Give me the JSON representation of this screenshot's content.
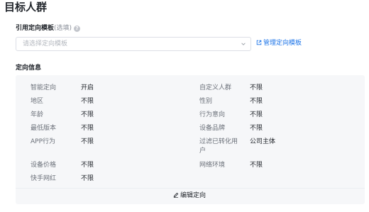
{
  "page_title": "目标人群",
  "template": {
    "label": "引用定向模板",
    "optional": "(选填)",
    "placeholder": "请选择定向模板",
    "manage_link": "管理定向模板"
  },
  "section_title": "定向信息",
  "left_items": [
    {
      "key": "智能定向",
      "value": "开启"
    },
    {
      "key": "地区",
      "value": "不限"
    },
    {
      "key": "年龄",
      "value": "不限"
    },
    {
      "key": "最低版本",
      "value": "不限"
    },
    {
      "key": "APP行为",
      "value": "不限"
    },
    {
      "key": "设备价格",
      "value": "不限"
    },
    {
      "key": "快手网红",
      "value": "不限"
    }
  ],
  "right_items": [
    {
      "key": "自定义人群",
      "value": "不限"
    },
    {
      "key": "性别",
      "value": "不限"
    },
    {
      "key": "行为意向",
      "value": "不限"
    },
    {
      "key": "设备品牌",
      "value": "不限"
    },
    {
      "key_line1": "过滤已转化用",
      "key_line2": "户",
      "value": "公司主体"
    },
    {
      "key": "网络环境",
      "value": "不限"
    }
  ],
  "edit_button": "编辑定向",
  "icons": {
    "help": "question-circle-icon",
    "chevron": "chevron-down-icon",
    "external": "external-link-icon",
    "edit": "pencil-icon"
  },
  "colors": {
    "link": "#1a73e8",
    "panel": "#f6f7f9"
  }
}
